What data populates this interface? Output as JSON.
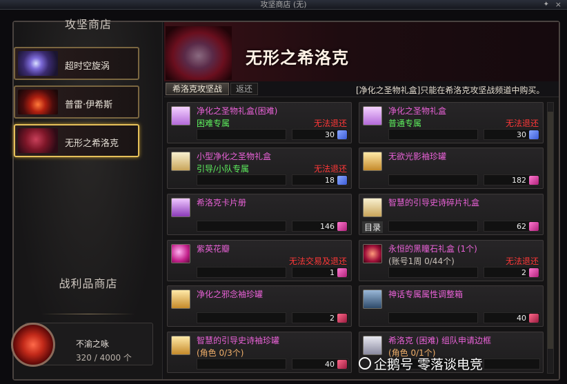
{
  "window": {
    "title": "攻坚商店 (无)",
    "pin_icon": "pin-icon",
    "close_icon": "close-icon"
  },
  "left": {
    "shop_title": "攻坚商店",
    "nav": [
      {
        "label": "超时空旋涡",
        "icon": "vortex-icon",
        "active": false
      },
      {
        "label": "普雷·伊希斯",
        "icon": "isis-icon",
        "active": false
      },
      {
        "label": "无形之希洛克",
        "icon": "hilloc-icon",
        "active": true
      }
    ],
    "trophy_title": "战利品商店",
    "trophy": {
      "name": "不渝之咏",
      "count": "320 / 4000 个",
      "icon": "trophy-emblem-icon"
    }
  },
  "header": {
    "boss_name": "无形之希洛克"
  },
  "tabs": [
    {
      "label": "希洛克攻坚战",
      "active": true
    },
    {
      "label": "返还",
      "active": false
    }
  ],
  "notice": "[净化之圣物礼盒]只能在希洛克攻坚战频道中购买。",
  "items": [
    {
      "name": "净化之圣物礼盒(困难)",
      "sub": "困难专属",
      "sub_color": "green",
      "warn": "无法退还",
      "price": "30",
      "currency": "cw",
      "icon": "relic-box-icon"
    },
    {
      "name": "净化之圣物礼盒",
      "sub": "普通专属",
      "sub_color": "green",
      "warn": "无法退还",
      "price": "30",
      "currency": "cw",
      "icon": "relic-box-icon"
    },
    {
      "name": "小型净化之圣物礼盒",
      "sub": "引导/小队专属",
      "sub_color": "green",
      "warn": "无法退还",
      "price": "18",
      "currency": "cw",
      "icon": "small-relic-box-icon"
    },
    {
      "name": "无欲光影袖珍罐",
      "sub": "",
      "sub_color": "",
      "warn": "",
      "price": "182",
      "currency": "pk",
      "icon": "pocket-jar-icon"
    },
    {
      "name": "希洛克卡片册",
      "sub": "",
      "sub_color": "",
      "warn": "",
      "price": "146",
      "currency": "pk",
      "icon": "card-album-icon"
    },
    {
      "name": "智慧的引导史诗碎片礼盒",
      "sub": "",
      "sub_color": "",
      "warn": "",
      "price": "62",
      "currency": "pk",
      "icon": "epic-shard-box-icon",
      "catalog": "目录"
    },
    {
      "name": "紫英花瓣",
      "sub": "",
      "sub_color": "",
      "warn": "无法交易及退还",
      "price": "1",
      "currency": "pk",
      "icon": "petal-icon"
    },
    {
      "name": "永恒的黑瞳石礼盒 (1个)",
      "sub": "(账号1周 0/44个)",
      "sub_color": "gray",
      "warn": "无法退还",
      "price": "2",
      "currency": "pk",
      "icon": "black-pupil-stone-icon"
    },
    {
      "name": "净化之邪念袖珍罐",
      "sub": "",
      "sub_color": "",
      "warn": "",
      "price": "2",
      "currency": "rd",
      "icon": "evil-jar-icon"
    },
    {
      "name": "神话专属属性调整箱",
      "sub": "",
      "sub_color": "",
      "warn": "",
      "price": "40",
      "currency": "rd",
      "icon": "myth-chest-icon"
    },
    {
      "name": "智慧的引导史诗袖珍罐",
      "sub": "(角色 0/3个)",
      "sub_color": "orange",
      "warn": "",
      "price": "40",
      "currency": "rd",
      "icon": "epic-jar-icon"
    },
    {
      "name": "希洛克 (困难) 组队申请边框",
      "sub": "(角色 0/1个)",
      "sub_color": "orange",
      "warn": "",
      "price": "",
      "currency": "",
      "icon": "party-frame-icon"
    }
  ],
  "watermark": "企鹅号 零落谈电竞"
}
